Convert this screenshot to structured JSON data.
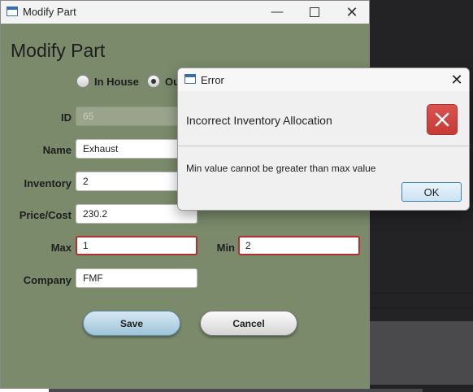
{
  "window": {
    "title": "Modify Part",
    "minimize_glyph": "—",
    "close_glyph": "✕"
  },
  "form": {
    "heading": "Modify Part",
    "radio_inhouse_label": "In House",
    "radio_outsourced_label": "Ou",
    "selected_source": "outsourced",
    "fields": {
      "id": {
        "label": "ID",
        "value": "65",
        "enabled": false
      },
      "name": {
        "label": "Name",
        "value": "Exhaust"
      },
      "inventory": {
        "label": "Inventory",
        "value": "2"
      },
      "price": {
        "label": "Price/Cost",
        "value": "230.2"
      },
      "max": {
        "label": "Max",
        "value": "1",
        "error": true
      },
      "min": {
        "label": "Min",
        "value": "2",
        "error": true
      },
      "company": {
        "label": "Company",
        "value": "FMF"
      }
    },
    "save_label": "Save",
    "cancel_label": "Cancel"
  },
  "dialog": {
    "title": "Error",
    "close_glyph": "✕",
    "header": "Incorrect Inventory Allocation",
    "error_icon": "error-x-icon",
    "error_color": "#d9534f",
    "content": "Min value cannot be greater than max value",
    "ok_label": "OK"
  },
  "colors": {
    "form_background": "#7b8a6b",
    "error_border": "#b03030",
    "save_button": "#9ec3d9"
  }
}
